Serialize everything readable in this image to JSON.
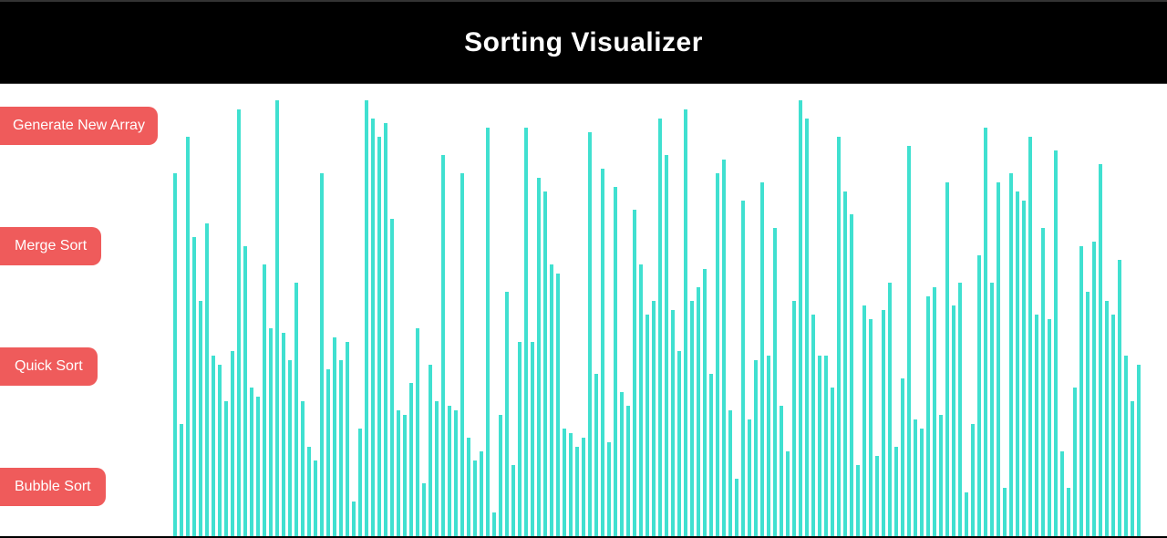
{
  "header": {
    "title": "Sorting Visualizer"
  },
  "sidebar": {
    "buttons": [
      {
        "label": "Generate New Array",
        "name": "generate-new-array-button"
      },
      {
        "label": "Merge Sort",
        "name": "merge-sort-button"
      },
      {
        "label": "Quick Sort",
        "name": "quick-sort-button"
      },
      {
        "label": "Bubble Sort",
        "name": "bubble-sort-button"
      }
    ]
  },
  "chart_data": {
    "type": "bar",
    "title": "Sorting Visualizer",
    "xlabel": "",
    "ylabel": "",
    "ylim": [
      0,
      480
    ],
    "bar_color": "#40e0d0",
    "values": [
      400,
      125,
      440,
      330,
      260,
      345,
      200,
      190,
      150,
      205,
      470,
      320,
      165,
      155,
      300,
      230,
      480,
      225,
      195,
      280,
      150,
      100,
      85,
      400,
      185,
      220,
      195,
      215,
      40,
      120,
      480,
      460,
      440,
      455,
      350,
      140,
      135,
      170,
      230,
      60,
      190,
      150,
      420,
      145,
      140,
      400,
      110,
      85,
      95,
      450,
      28,
      135,
      270,
      80,
      215,
      450,
      215,
      395,
      380,
      300,
      290,
      120,
      115,
      100,
      110,
      445,
      180,
      405,
      105,
      385,
      160,
      145,
      360,
      300,
      245,
      260,
      460,
      420,
      250,
      205,
      470,
      260,
      275,
      295,
      180,
      400,
      415,
      140,
      65,
      370,
      130,
      195,
      390,
      200,
      340,
      145,
      95,
      260,
      480,
      460,
      245,
      200,
      200,
      165,
      440,
      380,
      355,
      80,
      255,
      240,
      90,
      250,
      280,
      100,
      175,
      430,
      130,
      120,
      265,
      275,
      135,
      390,
      255,
      280,
      50,
      125,
      310,
      450,
      280,
      390,
      55,
      400,
      380,
      370,
      440,
      245,
      340,
      240,
      425,
      95,
      55,
      165,
      320,
      270,
      325,
      410,
      260,
      245,
      305,
      200,
      150,
      190
    ]
  }
}
